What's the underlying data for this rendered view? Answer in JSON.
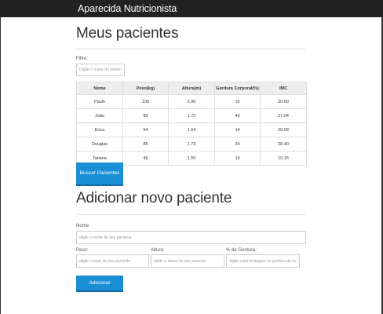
{
  "header": {
    "brand": "Aparecida Nutricionista"
  },
  "patients_section": {
    "title": "Meus pacientes",
    "filter_label": "Filtre:",
    "filter_placeholder": "Digite o nome do paciente",
    "table": {
      "headers": [
        "Nome",
        "Peso(kg)",
        "Altura(m)",
        "Gordura Corporal(%)",
        "IMC"
      ],
      "rows": [
        [
          "Paulo",
          "100",
          "2.00",
          "10",
          "25.00"
        ],
        [
          "João",
          "80",
          "1.72",
          "40",
          "27.04"
        ],
        [
          "Erica",
          "54",
          "1.64",
          "14",
          "20.08"
        ],
        [
          "Douglas",
          "85",
          "1.73",
          "24",
          "28.40"
        ],
        [
          "Tatiana",
          "46",
          "1.55",
          "19",
          "19.15"
        ]
      ]
    },
    "search_button": "Buscar Pacientes"
  },
  "add_section": {
    "title": "Adicionar novo paciente",
    "name_label": "Nome:",
    "name_placeholder": "digite o nome do seu paciente",
    "weight_label": "Peso:",
    "weight_placeholder": "digite o peso do seu paciente",
    "height_label": "Altura:",
    "height_placeholder": "digite a altura do seu paciente",
    "fat_label": "% de Gordura:",
    "fat_placeholder": "digite a porcentagem de gordura do seu paciente",
    "add_button": "Adicionar"
  },
  "colors": {
    "topbar": "#222222",
    "button": "#1a8fd6",
    "table_header": "#eeeeee",
    "border": "#dddddd"
  }
}
